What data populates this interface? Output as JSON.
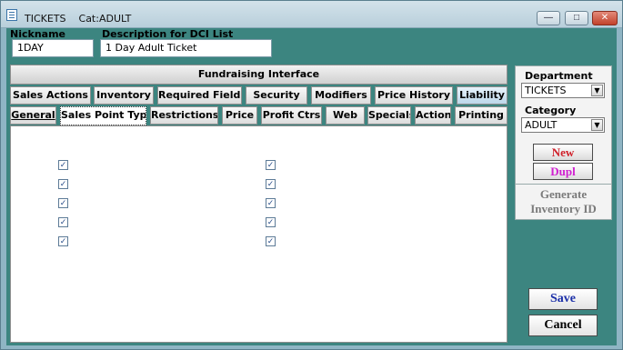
{
  "window": {
    "title": "TICKETS",
    "subtitle": "Cat:ADULT",
    "buttons": {
      "minimize": "—",
      "maximize": "□",
      "close": "✕"
    }
  },
  "header": {
    "nickname_label": "Nickname",
    "nickname_value": "1DAY",
    "description_label": "Description for DCI List",
    "description_value": "1 Day Adult Ticket"
  },
  "panel": {
    "title": "Fundraising Interface",
    "tabs_row1": [
      "Sales Actions",
      "Inventory",
      "Required Fields",
      "Security",
      "Modifiers",
      "Price History",
      "Liability"
    ],
    "tabs_row2": [
      "General",
      "Sales Point Type",
      "Restrictions",
      "Price",
      "Profit Ctrs",
      "Web",
      "Specials",
      "Action",
      "Printing"
    ],
    "active_row1": "Liability",
    "selected_row2": "Sales Point Type"
  },
  "checkboxes": {
    "left_column": [
      true,
      true,
      true,
      true,
      true
    ],
    "right_column": [
      true,
      true,
      true,
      true,
      true
    ],
    "check_glyph": "✓"
  },
  "sidebar": {
    "department_label": "Department",
    "department_value": "TICKETS",
    "category_label": "Category",
    "category_value": "ADULT",
    "new_label": "New",
    "dupl_label": "Dupl",
    "generate_label_line1": "Generate",
    "generate_label_line2": "Inventory ID",
    "save_label": "Save",
    "cancel_label": "Cancel"
  },
  "colors": {
    "client_bg": "#3c8580",
    "new_text": "#d0202a",
    "dupl_text": "#d020d0",
    "save_text": "#1b2fa8"
  }
}
